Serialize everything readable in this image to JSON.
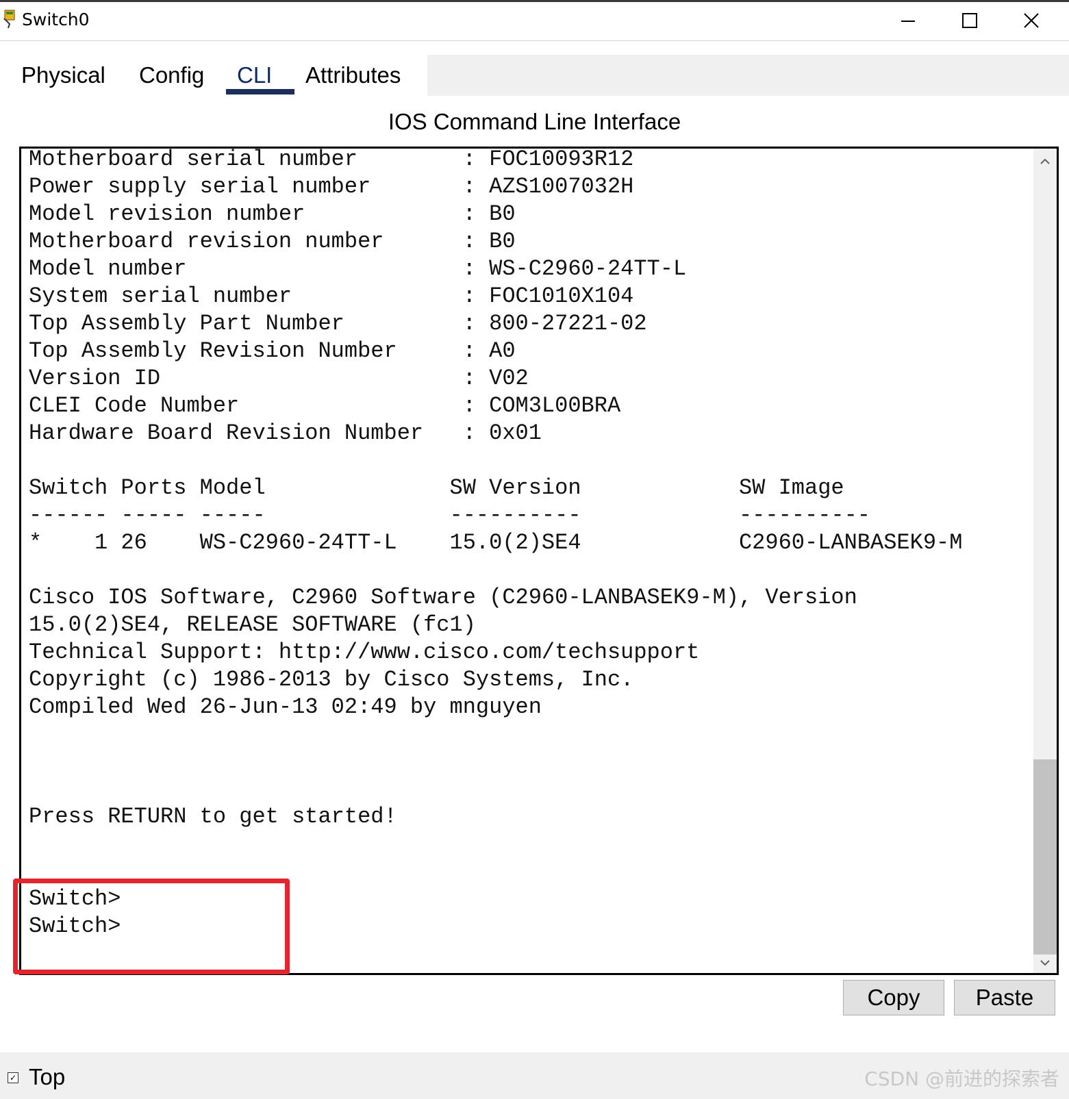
{
  "window": {
    "title": "Switch0",
    "minimize_label": "minimize",
    "maximize_label": "maximize",
    "close_label": "close"
  },
  "tabs": [
    {
      "label": "Physical",
      "active": false
    },
    {
      "label": "Config",
      "active": false
    },
    {
      "label": "CLI",
      "active": true
    },
    {
      "label": "Attributes",
      "active": false
    }
  ],
  "panel": {
    "title": "IOS Command Line Interface"
  },
  "terminal": {
    "lines": [
      "Motherboard serial number        : FOC10093R12",
      "Power supply serial number       : AZS1007032H",
      "Model revision number            : B0",
      "Motherboard revision number      : B0",
      "Model number                     : WS-C2960-24TT-L",
      "System serial number             : FOC1010X104",
      "Top Assembly Part Number         : 800-27221-02",
      "Top Assembly Revision Number     : A0",
      "Version ID                       : V02",
      "CLEI Code Number                 : COM3L00BRA",
      "Hardware Board Revision Number   : 0x01",
      "",
      "Switch Ports Model              SW Version            SW Image",
      "------ ----- -----              ----------            ----------",
      "*    1 26    WS-C2960-24TT-L    15.0(2)SE4            C2960-LANBASEK9-M",
      "",
      "Cisco IOS Software, C2960 Software (C2960-LANBASEK9-M), Version",
      "15.0(2)SE4, RELEASE SOFTWARE (fc1)",
      "Technical Support: http://www.cisco.com/techsupport",
      "Copyright (c) 1986-2013 by Cisco Systems, Inc.",
      "Compiled Wed 26-Jun-13 02:49 by mnguyen",
      "",
      "",
      "",
      "Press RETURN to get started!",
      "",
      "",
      "Switch>",
      "Switch>"
    ]
  },
  "buttons": {
    "copy": "Copy",
    "paste": "Paste"
  },
  "footer": {
    "checkbox_label": "Top",
    "watermark": "CSDN @前进的探索者"
  },
  "colors": {
    "highlight": "#e3262d",
    "active_tab_underline": "#1b2f5c"
  }
}
